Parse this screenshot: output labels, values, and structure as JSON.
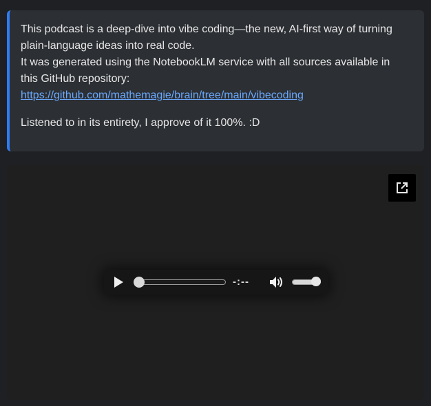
{
  "note": {
    "line1": "This podcast is a deep-dive into vibe coding—the new, AI-first way of turning plain-language ideas into real code.",
    "line2": "It was generated using the NotebookLM service with all sources available in this GitHub repository:",
    "link_text": "https://github.com/mathemagie/brain/tree/main/vibecoding",
    "closing": "Listened to in its entirety, I approve of it 100%. :D",
    "accent_color": "#2f7cf6",
    "link_color": "#6aa9ff"
  },
  "player": {
    "external_icon": "open-in-new-icon",
    "play_icon": "play-icon",
    "volume_icon": "speaker-volume-icon",
    "time_display": "-:--",
    "progress": 0.0,
    "volume": 1.0
  }
}
